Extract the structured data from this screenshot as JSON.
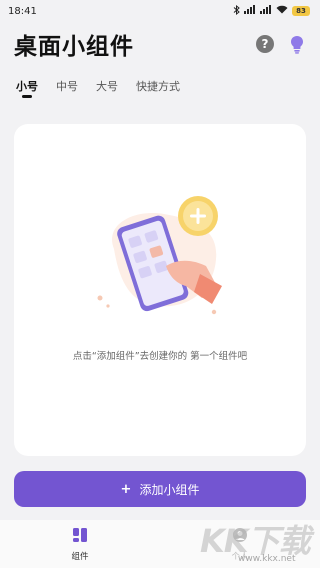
{
  "status_bar": {
    "time": "18:41",
    "icons": [
      "bluetooth-icon",
      "signal-icon",
      "signal-icon",
      "wifi-icon"
    ],
    "battery": "83"
  },
  "header": {
    "title": "桌面小组件",
    "help_icon": "help-icon",
    "theme_icon": "lightbulb-icon"
  },
  "tabs": [
    {
      "label": "小号",
      "active": true
    },
    {
      "label": "中号",
      "active": false
    },
    {
      "label": "大号",
      "active": false
    },
    {
      "label": "快捷方式",
      "active": false
    }
  ],
  "preview": {
    "empty_text": "点击“添加组件”去创建你的 第一个组件吧"
  },
  "add_button": {
    "icon": "+",
    "label": "添加小组件"
  },
  "bottom_nav": [
    {
      "label": "组件",
      "icon": "widgets-icon",
      "active": true
    },
    {
      "label": "个人",
      "icon": "profile-icon",
      "active": false
    }
  ],
  "watermark": {
    "text": "KK下载",
    "url": "www.kkx.net"
  },
  "colors": {
    "accent": "#7355d1",
    "background": "#f2f2f4",
    "card": "#ffffff"
  }
}
